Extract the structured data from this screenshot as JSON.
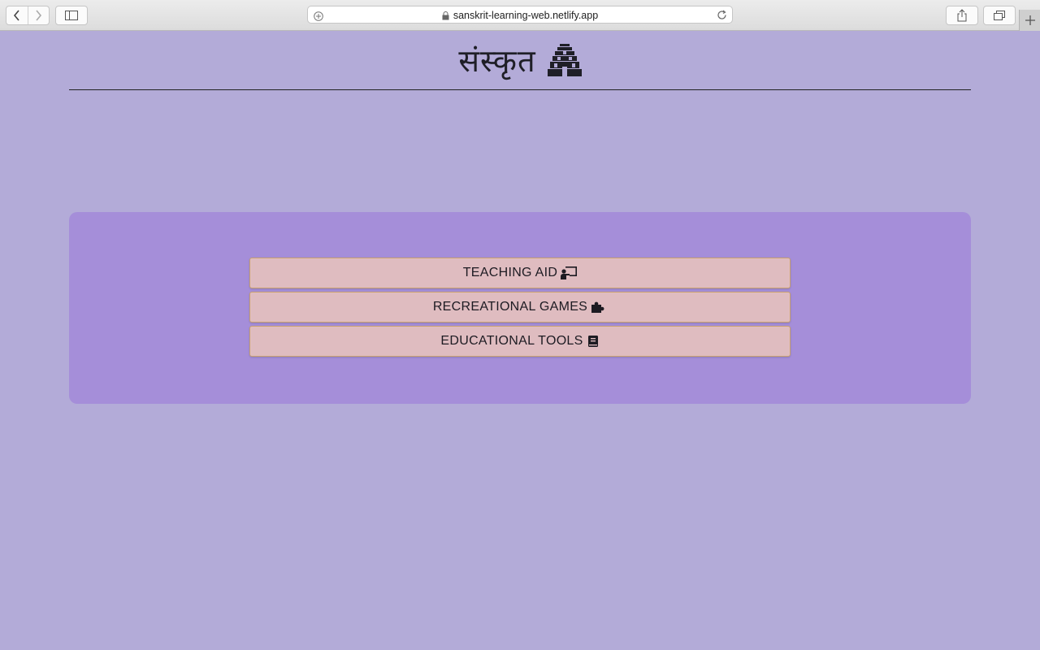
{
  "browser": {
    "url": "sanskrit-learning-web.netlify.app"
  },
  "header": {
    "title": "संस्कृत"
  },
  "menu": {
    "teaching_aid": "TEACHING AID",
    "recreational_games": "RECREATIONAL GAMES",
    "educational_tools": "EDUCATIONAL TOOLS"
  },
  "icons": {
    "logo": "temple-icon",
    "teaching": "chalkboard-teacher-icon",
    "games": "puzzle-piece-icon",
    "tools": "book-icon"
  },
  "colors": {
    "page_bg": "#b3abd8",
    "panel_bg": "#a58ed9",
    "button_bg": "#dfbcc0",
    "button_border": "#c8a06f"
  }
}
